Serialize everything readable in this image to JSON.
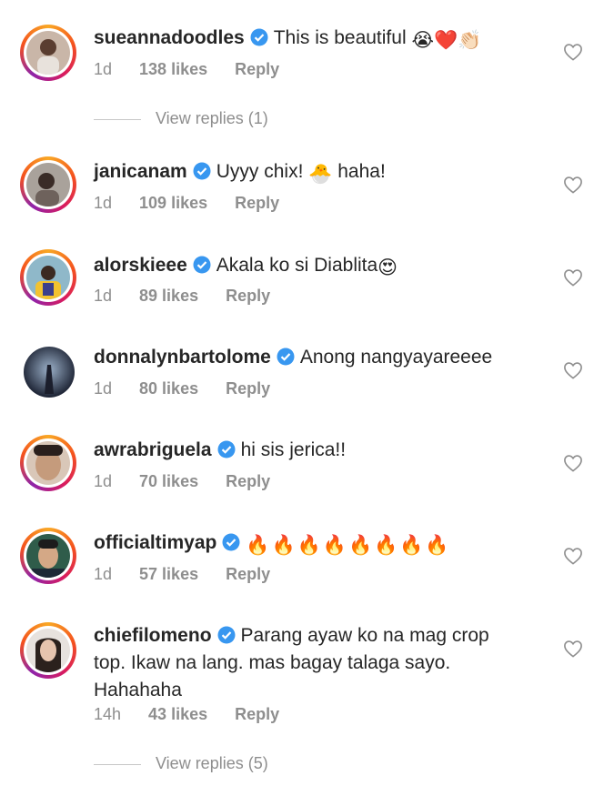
{
  "comments": [
    {
      "username": "sueannadoodles",
      "text": "This is beautiful",
      "emoji": "😭❤️👏🏻",
      "time": "1d",
      "likes": "138 likes",
      "reply": "Reply"
    },
    {
      "username": "janicanam",
      "text": "Uyyy chix!",
      "emoji": "🐣",
      "text_after": "haha!",
      "time": "1d",
      "likes": "109 likes",
      "reply": "Reply"
    },
    {
      "username": "alorskieee",
      "text": "Akala ko si Diablita",
      "emoji": "😍",
      "time": "1d",
      "likes": "89 likes",
      "reply": "Reply"
    },
    {
      "username": "donnalynbartolome",
      "text": "Anong nangyayareeee",
      "time": "1d",
      "likes": "80 likes",
      "reply": "Reply"
    },
    {
      "username": "awrabriguela",
      "text": "hi sis jerica!!",
      "time": "1d",
      "likes": "70 likes",
      "reply": "Reply"
    },
    {
      "username": "officialtimyap",
      "text": "",
      "emoji": "🔥🔥🔥🔥🔥🔥🔥🔥",
      "time": "1d",
      "likes": "57 likes",
      "reply": "Reply"
    },
    {
      "username": "chiefilomeno",
      "text_line1": "Parang ayaw ko na mag crop",
      "text_line2": "top. Ikaw na lang. mas bagay talaga sayo.",
      "text_line3": "Hahahaha",
      "time": "14h",
      "likes": "43 likes",
      "reply": "Reply"
    }
  ],
  "view_replies": [
    "View replies (1)",
    "View replies (5)"
  ],
  "icons": {
    "verified": "verified-badge-icon",
    "like": "heart-outline-icon"
  },
  "colors": {
    "verified": "#3897f0",
    "meta": "#8e8e8e",
    "text": "#262626"
  }
}
